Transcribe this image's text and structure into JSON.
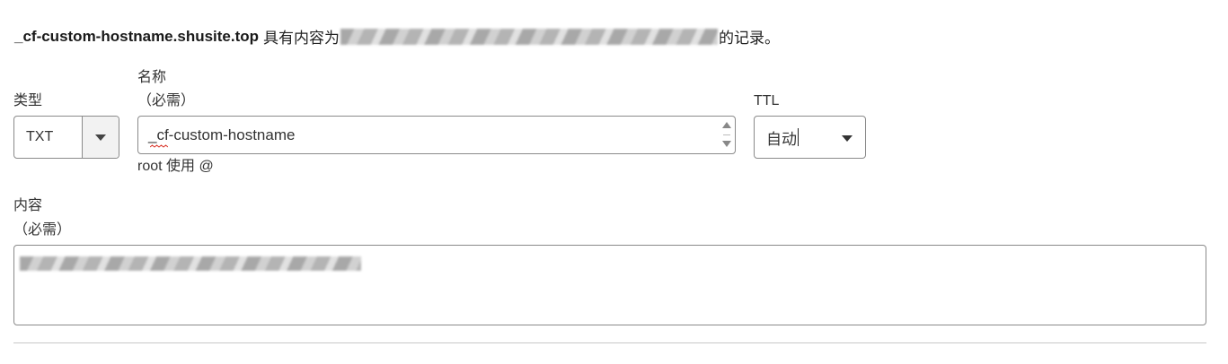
{
  "summary": {
    "hostname": "_cf-custom-hostname.shusite.top",
    "middle_text": "具有内容为",
    "end_text": "的记录。"
  },
  "type_field": {
    "label": "类型",
    "value": "TXT",
    "icon": "chevron-down-icon"
  },
  "name_field": {
    "label": "名称",
    "required": "（必需）",
    "value": "_cf-custom-hostname",
    "hint": "root 使用 @",
    "icon": "spinner-icon"
  },
  "ttl_field": {
    "label": "TTL",
    "value": "自动",
    "icon": "chevron-down-icon"
  },
  "content_field": {
    "label": "内容",
    "required": "（必需）"
  }
}
